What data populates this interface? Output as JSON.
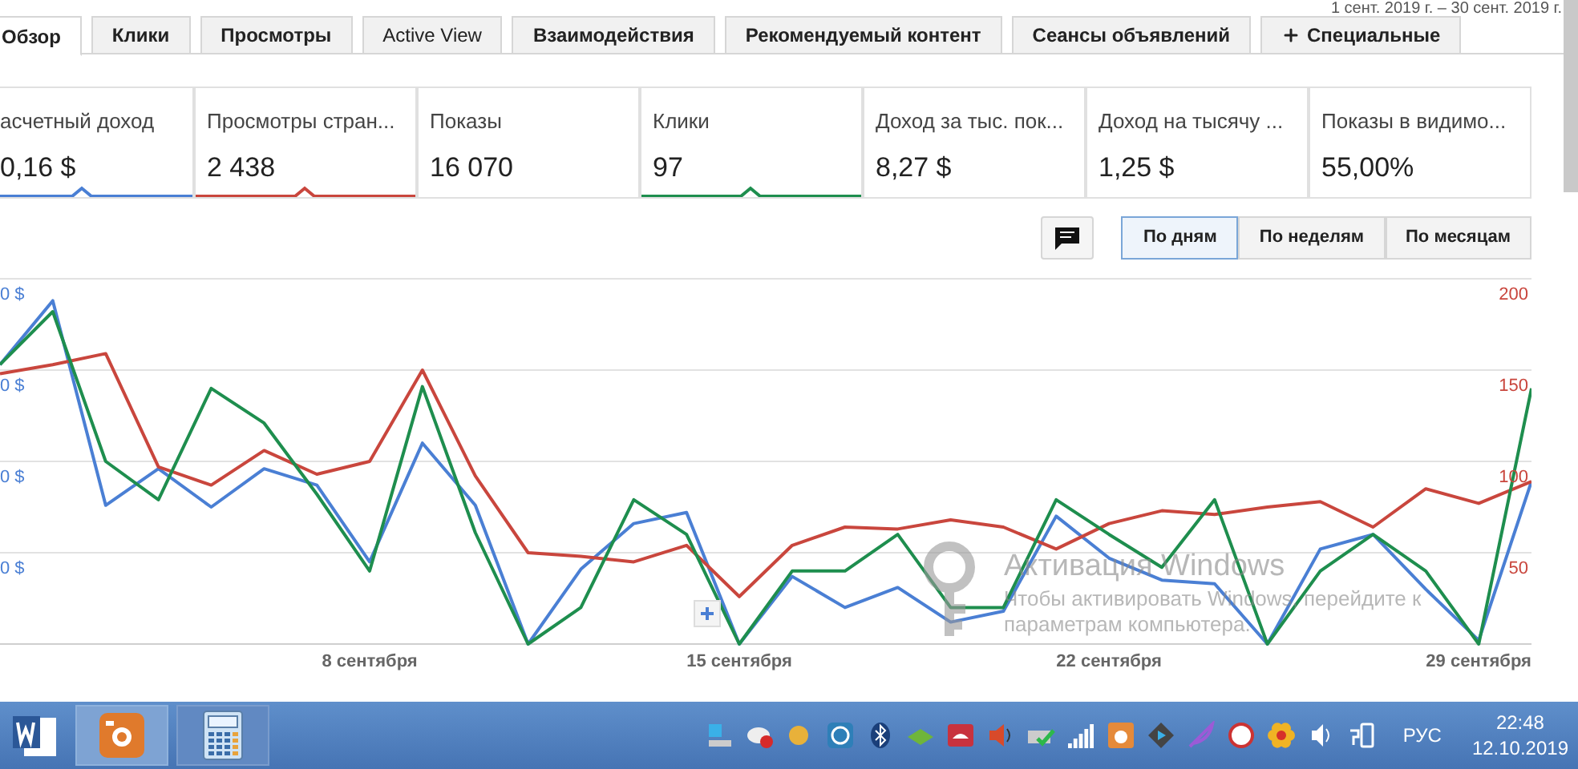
{
  "date_range": "1 сент. 2019 г. – 30 сент. 2019 г.",
  "tabs": [
    {
      "label": "Обзор",
      "selected": true,
      "kind": "plain"
    },
    {
      "label": "Клики",
      "selected": false,
      "kind": "plain"
    },
    {
      "label": "Просмотры",
      "selected": false,
      "kind": "plain"
    },
    {
      "label": "Active View",
      "selected": false,
      "kind": "plain"
    },
    {
      "label": "Взаимодействия",
      "selected": false,
      "kind": "plain"
    },
    {
      "label": "Рекомендуемый контент",
      "selected": false,
      "kind": "plain"
    },
    {
      "label": "Сеансы объявлений",
      "selected": false,
      "kind": "plain"
    },
    {
      "label": "Специальные",
      "selected": false,
      "kind": "add"
    }
  ],
  "metrics": [
    {
      "label": "асчетный доход",
      "value": "0,16 $",
      "color": "#4a7fd4"
    },
    {
      "label": "Просмотры стран...",
      "value": "2 438",
      "color": "#c9463d"
    },
    {
      "label": "Показы",
      "value": "16 070"
    },
    {
      "label": "Клики",
      "value": "97",
      "color": "#1e8e4e"
    },
    {
      "label": "Доход за тыс. пок...",
      "value": "8,27 $"
    },
    {
      "label": "Доход на тысячу ...",
      "value": "1,25 $"
    },
    {
      "label": "Показы в видимо...",
      "value": "55,00%"
    }
  ],
  "periods": [
    {
      "label": "По дням",
      "selected": true
    },
    {
      "label": "По неделям",
      "selected": false
    },
    {
      "label": "По месяцам",
      "selected": false
    }
  ],
  "chart": {
    "left_axis_labels": [
      "0 $",
      "0 $",
      "0 $",
      "0 $"
    ],
    "chart_data": {
      "type": "line",
      "x": [
        1,
        2,
        3,
        4,
        5,
        6,
        7,
        8,
        9,
        10,
        11,
        12,
        13,
        14,
        15,
        16,
        17,
        18,
        19,
        20,
        21,
        22,
        23,
        24,
        25,
        26,
        27,
        28,
        29,
        30
      ],
      "xticks": [
        {
          "value": 8,
          "label": "8 сентября"
        },
        {
          "value": 15,
          "label": "15 сентября"
        },
        {
          "value": 22,
          "label": "22 сентября"
        },
        {
          "value": 29,
          "label": "29 сентября"
        }
      ],
      "xlim": [
        1,
        30
      ],
      "yticks": [
        50,
        100,
        150,
        200
      ],
      "ylim": [
        0,
        200
      ],
      "grid": true,
      "series": [
        {
          "color": "#4a7fd4",
          "values": [
            153,
            188,
            76,
            96,
            75,
            96,
            87,
            45,
            110,
            76,
            0,
            41,
            66,
            72,
            0,
            37,
            20,
            31,
            12,
            18,
            70,
            47,
            35,
            33,
            0,
            52,
            60,
            30,
            2,
            89
          ]
        },
        {
          "color": "#c9463d",
          "values": [
            148,
            153,
            159,
            97,
            87,
            106,
            93,
            100,
            150,
            92,
            50,
            48,
            45,
            54,
            26,
            54,
            64,
            63,
            68,
            64,
            52,
            66,
            73,
            71,
            75,
            78,
            64,
            85,
            77,
            89
          ]
        },
        {
          "color": "#1e8e4e",
          "values": [
            153,
            182,
            100,
            79,
            140,
            121,
            82,
            40,
            141,
            61,
            0,
            20,
            79,
            60,
            0,
            40,
            40,
            60,
            20,
            20,
            79,
            60,
            42,
            79,
            0,
            40,
            60,
            40,
            0,
            140
          ]
        }
      ]
    }
  },
  "activation": {
    "title": "Активация Windows",
    "line1": "Чтобы активировать Windows, перейдите к",
    "line2": "параметрам компьютера."
  },
  "taskbar": {
    "apps": [
      {
        "kind": "word",
        "selected": false
      },
      {
        "kind": "camera",
        "selected": true
      },
      {
        "kind": "calculator",
        "selected": false
      }
    ],
    "language": "РУС",
    "time": "22:48",
    "date": "12.10.2019"
  }
}
